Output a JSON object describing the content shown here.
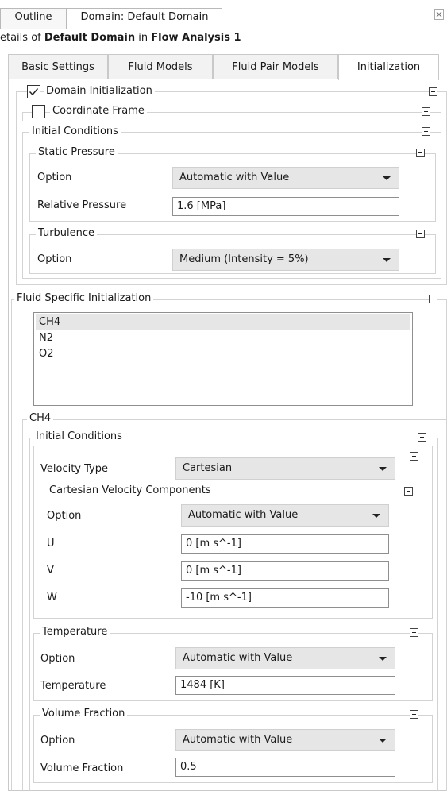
{
  "top_tabs": {
    "outline": "Outline",
    "domain": "Domain: Default Domain"
  },
  "details": {
    "prefix": "etails of ",
    "object": "Default Domain",
    "middle": " in ",
    "analysis": "Flow Analysis 1"
  },
  "sub_tabs": [
    "Basic Settings",
    "Fluid Models",
    "Fluid Pair Models",
    "Initialization"
  ],
  "active_sub_tab": "Initialization",
  "domain_init": {
    "label": "Domain Initialization",
    "checked": true
  },
  "coord_frame": {
    "label": "Coordinate Frame",
    "checked": false
  },
  "initial_conditions": {
    "title": "Initial Conditions",
    "static_pressure": {
      "title": "Static Pressure",
      "option_label": "Option",
      "option_value": "Automatic with Value",
      "rel_label": "Relative Pressure",
      "rel_value": "1.6 [MPa]"
    },
    "turbulence": {
      "title": "Turbulence",
      "option_label": "Option",
      "option_value": "Medium (Intensity = 5%)"
    }
  },
  "fluid_specific": {
    "title": "Fluid Specific Initialization",
    "fluids": [
      "CH4",
      "N2",
      "O2"
    ],
    "selected": "CH4",
    "section_title": "CH4",
    "ic_title": "Initial Conditions",
    "velocity_type_label": "Velocity Type",
    "velocity_type_value": "Cartesian",
    "cart_title": "Cartesian Velocity Components",
    "cart_option_label": "Option",
    "cart_option_value": "Automatic with Value",
    "u_label": "U",
    "u_value": "0 [m s^-1]",
    "v_label": "V",
    "v_value": "0 [m s^-1]",
    "w_label": "W",
    "w_value": "-10 [m s^-1]",
    "temperature": {
      "title": "Temperature",
      "option_label": "Option",
      "option_value": "Automatic with Value",
      "temp_label": "Temperature",
      "temp_value": "1484 [K]"
    },
    "volume_fraction": {
      "title": "Volume Fraction",
      "option_label": "Option",
      "option_value": "Automatic with Value",
      "vf_label": "Volume Fraction",
      "vf_value": "0.5"
    }
  }
}
